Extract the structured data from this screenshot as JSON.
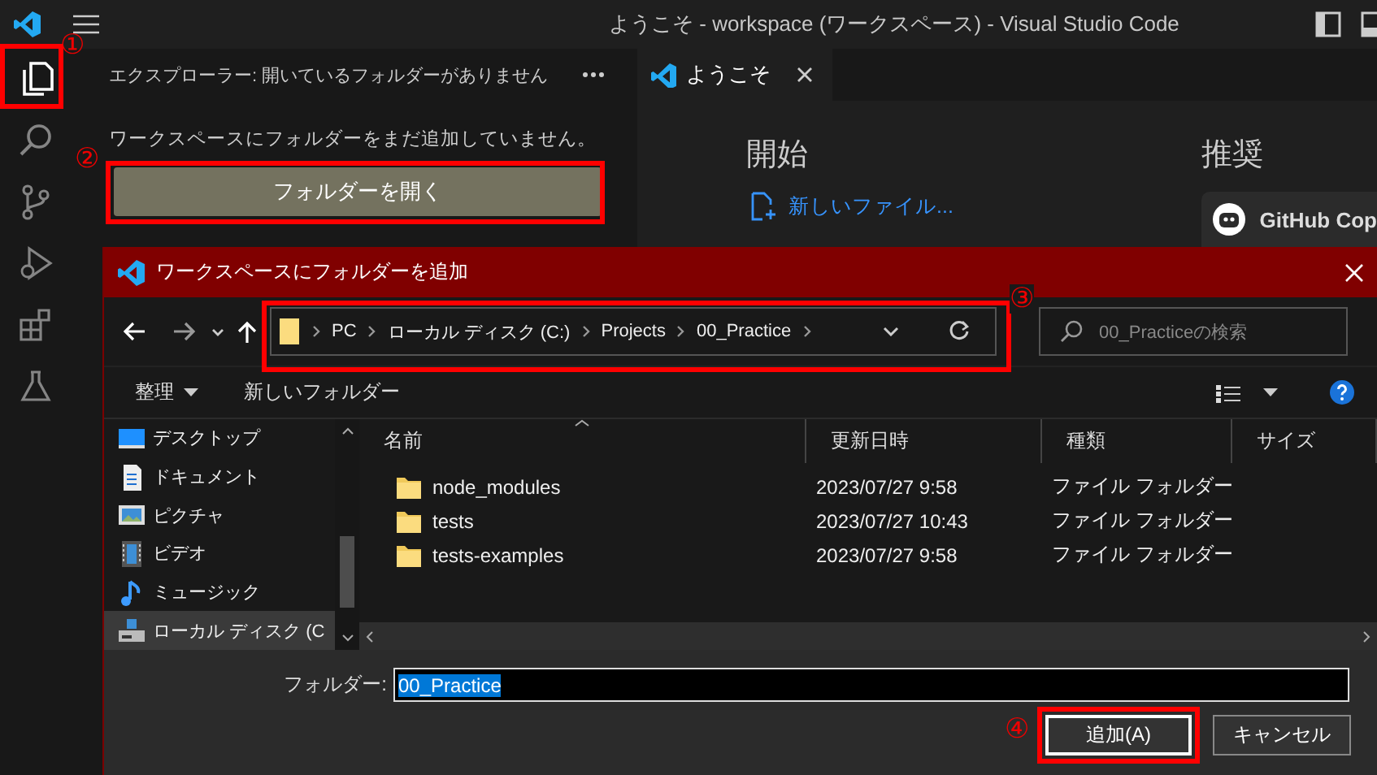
{
  "window": {
    "title": "ようこそ - workspace (ワークスペース) - Visual Studio Code"
  },
  "activity_bar": {
    "items": [
      {
        "kind": "files",
        "selected": true,
        "callout": "①"
      },
      {
        "kind": "search",
        "selected": false
      },
      {
        "kind": "source-control",
        "selected": false
      },
      {
        "kind": "run-debug",
        "selected": false
      },
      {
        "kind": "extensions",
        "selected": false
      },
      {
        "kind": "testing",
        "selected": false
      }
    ]
  },
  "sidebar": {
    "title": "エクスプローラー: 開いているフォルダーがありません",
    "message": "ワークスペースにフォルダーをまだ追加していません。",
    "button": {
      "label": "フォルダーを開く",
      "callout": "②"
    }
  },
  "editor": {
    "tabs": [
      {
        "label": "ようこそ",
        "selected": true
      }
    ],
    "start": {
      "heading": "開始",
      "items": [
        "新しいファイル..."
      ]
    },
    "recommended": {
      "heading": "推奨",
      "card_title": "GitHub Cop"
    }
  },
  "dialog": {
    "title": "ワークスペースにフォルダーを追加",
    "breadcrumb": {
      "items": [
        "PC",
        "ローカル ディスク (C:)",
        "Projects",
        "00_Practice"
      ],
      "callout": "③"
    },
    "search": {
      "placeholder": "00_Practiceの検索"
    },
    "toolbar": {
      "organize": "整理",
      "new_folder": "新しいフォルダー"
    },
    "nav_items": [
      {
        "label": "デスクトップ",
        "kind": "desktop",
        "selected": false
      },
      {
        "label": "ドキュメント",
        "kind": "document",
        "selected": false
      },
      {
        "label": "ピクチャ",
        "kind": "picture",
        "selected": false
      },
      {
        "label": "ビデオ",
        "kind": "video",
        "selected": false
      },
      {
        "label": "ミュージック",
        "kind": "music",
        "selected": false
      },
      {
        "label": "ローカル ディスク (C",
        "kind": "drive",
        "selected": true
      }
    ],
    "columns": [
      {
        "label": "名前",
        "sorted": true
      },
      {
        "label": "更新日時",
        "sorted": false
      },
      {
        "label": "種類",
        "sorted": false
      },
      {
        "label": "サイズ",
        "sorted": false
      }
    ],
    "rows": [
      {
        "name": "node_modules",
        "modified": "2023/07/27 9:58",
        "type": "ファイル フォルダー"
      },
      {
        "name": "tests",
        "modified": "2023/07/27 10:43",
        "type": "ファイル フォルダー"
      },
      {
        "name": "tests-examples",
        "modified": "2023/07/27 9:58",
        "type": "ファイル フォルダー"
      }
    ],
    "folder_field": {
      "label": "フォルダー:",
      "value": "00_Practice",
      "value_selected": true
    },
    "buttons": [
      {
        "label": "追加(A)",
        "kind": "primary",
        "callout": "④"
      },
      {
        "label": "キャンセル",
        "kind": "secondary"
      }
    ]
  }
}
